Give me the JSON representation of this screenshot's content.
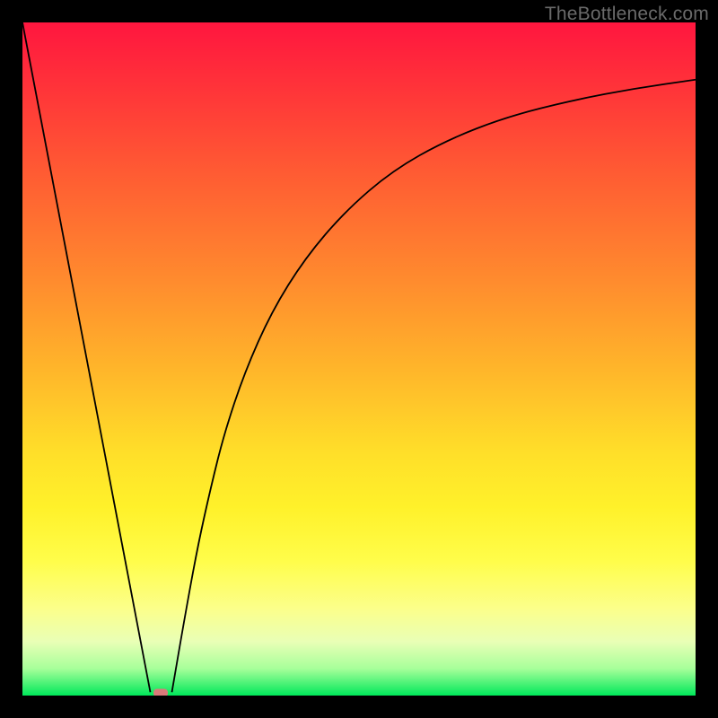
{
  "watermark": "TheBottleneck.com",
  "marker": {
    "x_frac": 0.205,
    "y_frac": 0.996
  },
  "chart_data": {
    "type": "line",
    "title": "",
    "xlabel": "",
    "ylabel": "",
    "xlim": [
      0,
      1
    ],
    "ylim": [
      0,
      1
    ],
    "grid": false,
    "legend": false,
    "annotations": [
      "TheBottleneck.com"
    ],
    "background_gradient": {
      "orientation": "vertical",
      "stops": [
        {
          "pos": 0.0,
          "color": "#ff163f"
        },
        {
          "pos": 0.5,
          "color": "#ffb72a"
        },
        {
          "pos": 0.8,
          "color": "#fffd4a"
        },
        {
          "pos": 1.0,
          "color": "#00e85a"
        }
      ]
    },
    "series": [
      {
        "name": "left-segment",
        "type": "line",
        "x": [
          0.0,
          0.19
        ],
        "y": [
          1.0,
          0.005
        ]
      },
      {
        "name": "right-curve",
        "type": "line",
        "x": [
          0.222,
          0.24,
          0.26,
          0.28,
          0.3,
          0.33,
          0.37,
          0.42,
          0.48,
          0.55,
          0.63,
          0.72,
          0.82,
          0.91,
          1.0
        ],
        "y": [
          0.005,
          0.11,
          0.22,
          0.31,
          0.39,
          0.48,
          0.57,
          0.65,
          0.72,
          0.78,
          0.825,
          0.86,
          0.885,
          0.902,
          0.915
        ]
      }
    ],
    "marker": {
      "shape": "pill",
      "color": "#d97a7a",
      "x": 0.205,
      "y": 0.004
    }
  }
}
